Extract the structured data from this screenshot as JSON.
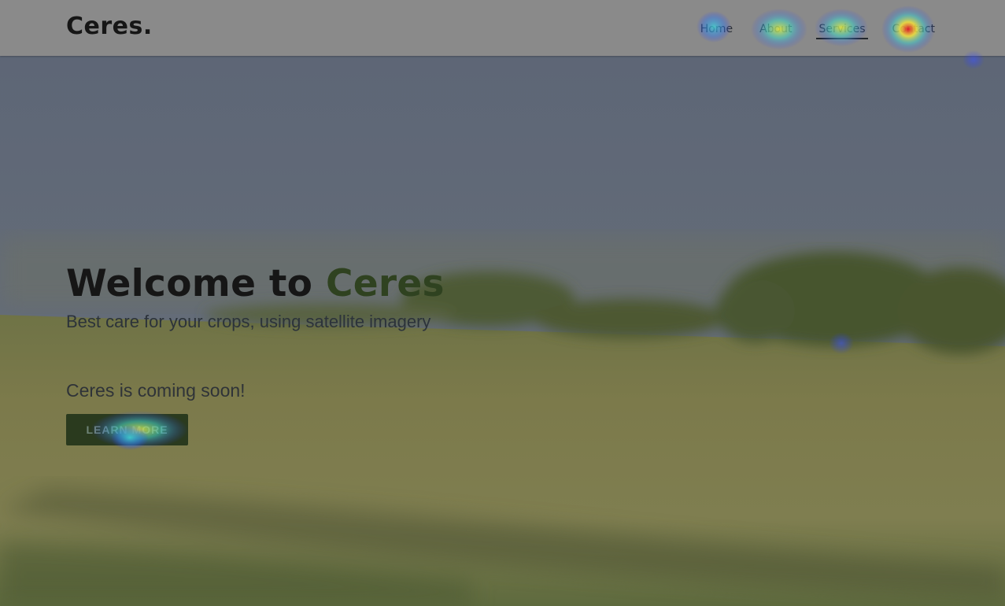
{
  "header": {
    "brand": "Ceres.",
    "nav": [
      {
        "label": "Home",
        "active": false
      },
      {
        "label": "About",
        "active": false
      },
      {
        "label": "Services",
        "active": true
      },
      {
        "label": "Contact",
        "active": false
      }
    ]
  },
  "hero": {
    "title_prefix": "Welcome to ",
    "title_accent": "Ceres",
    "subtitle": "Best care for your crops, using satellite imagery",
    "coming_soon": "Ceres is coming soon!",
    "cta_label": "LEARN MORE"
  },
  "colors": {
    "header_bg": "#8a8a8a",
    "brand_text": "#161616",
    "accent_green": "#2f4220",
    "button_bg": "#2a3a1e",
    "sky": "#5f6776",
    "field": "#7d7c4c"
  }
}
